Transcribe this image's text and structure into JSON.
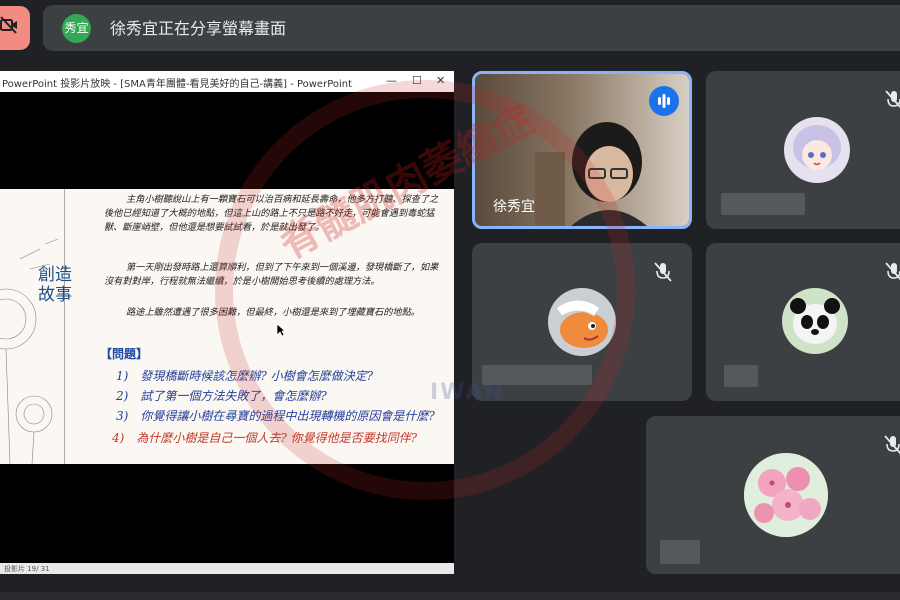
{
  "banner": {
    "avatar": "秀宜",
    "text": "徐秀宜正在分享螢幕畫面"
  },
  "ppt": {
    "title": "PowerPoint 投影片放映 - [SMA青年團體-看見美好的自己-講義] - PowerPoint",
    "slide_heading": "創造故事",
    "paragraphs": [
      "主角小樹聽說山上有一顆寶石可以治百病和延長壽命，他多方打聽、探查了之後他已經知道了大概的地點，但這上山的路上不只是路不好走，可能會遇到毒蛇猛獸、斷崖峭壁，但他還是想要試試看，於是就出發了。",
      "第一天剛出發時路上還算順利，但到了下午來到一個溪邊，發現橋斷了，如果沒有對對岸，行程就無法繼續，於是小樹開始思考後續的處理方法。",
      "路途上雖然遭遇了很多困難，但最終，小樹還是來到了埋藏寶石的地點。"
    ],
    "questions_heading": "【問題】",
    "questions": [
      "1)　發現橋斷時候該怎麼辦? 小樹會怎麼做決定?",
      "2)　試了第一個方法失敗了，會怎麼辦?",
      "3)　你覺得讓小樹在尋寶的過程中出現轉機的原因會是什麼?",
      "4)　為什麼小樹是自己一個人去? 你覺得他是否要找同伴?"
    ],
    "status_text": "投影片 19/ 31"
  },
  "tiles": {
    "speaker_name": "徐秀宜"
  },
  "colors": {
    "accent": "#8ab4f8",
    "tile_bg": "#3c4043",
    "page_bg": "#202124",
    "speaking": "#1a73e8"
  },
  "icons": [
    "camera-off-icon",
    "audio-level-icon",
    "mic-off-icon",
    "minimize-icon",
    "maximize-icon",
    "close-icon"
  ]
}
